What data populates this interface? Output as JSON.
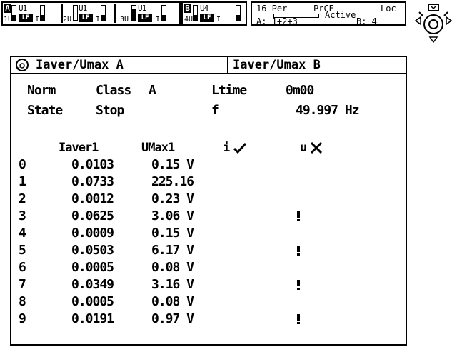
{
  "channels": {
    "group_a": "A",
    "group_b": "B",
    "items": [
      {
        "name": "U1",
        "num": "1U",
        "badge": "LF",
        "unit": "I",
        "level": 0.35
      },
      {
        "name": "U1",
        "num": "2U",
        "badge": "LF",
        "unit": "I",
        "level": 0.35
      },
      {
        "name": "U1",
        "num": "3U",
        "badge": "LF",
        "unit": "I",
        "level": 0.75
      },
      {
        "name": "U4",
        "num": "4U",
        "badge": "LF",
        "unit": "I",
        "level": 0.35
      }
    ]
  },
  "status": {
    "per": "16 Per",
    "prce": "PrCE",
    "loc": "Loc",
    "active": "Active",
    "a_label": "A: 1+2+3",
    "b_label": "B: 4"
  },
  "tabs": {
    "a": "Iaver/Umax A",
    "b": "Iaver/Umax B"
  },
  "info": {
    "norm_label": "Norm",
    "class_label": "Class",
    "class_value": "A",
    "ltime_label": "Ltime",
    "ltime_value": "0m00",
    "state_label": "State",
    "state_value": "Stop",
    "f_label": "f",
    "f_value": "49.997 Hz"
  },
  "table": {
    "col_iaver": "Iaver1",
    "col_umax": "UMax1",
    "col_i": "i",
    "col_u": "u",
    "rows": [
      {
        "n": "0",
        "iaver": "0.0103",
        "umax": "0.15 V",
        "flag": false
      },
      {
        "n": "1",
        "iaver": "0.0733",
        "umax": "225.16",
        "flag": false
      },
      {
        "n": "2",
        "iaver": "0.0012",
        "umax": "0.23 V",
        "flag": false
      },
      {
        "n": "3",
        "iaver": "0.0625",
        "umax": "3.06 V",
        "flag": true
      },
      {
        "n": "4",
        "iaver": "0.0009",
        "umax": "0.15 V",
        "flag": false
      },
      {
        "n": "5",
        "iaver": "0.0503",
        "umax": "6.17 V",
        "flag": true
      },
      {
        "n": "6",
        "iaver": "0.0005",
        "umax": "0.08 V",
        "flag": false
      },
      {
        "n": "7",
        "iaver": "0.0349",
        "umax": "3.16 V",
        "flag": true
      },
      {
        "n": "8",
        "iaver": "0.0005",
        "umax": "0.08 V",
        "flag": false
      },
      {
        "n": "9",
        "iaver": "0.0191",
        "umax": "0.97 V",
        "flag": true
      }
    ]
  },
  "icons": {
    "check": "check-icon",
    "cross": "cross-icon",
    "knob": "rotary-knob-icon",
    "tab": "tab-knob-icon",
    "flag": "exclamation-icon"
  }
}
